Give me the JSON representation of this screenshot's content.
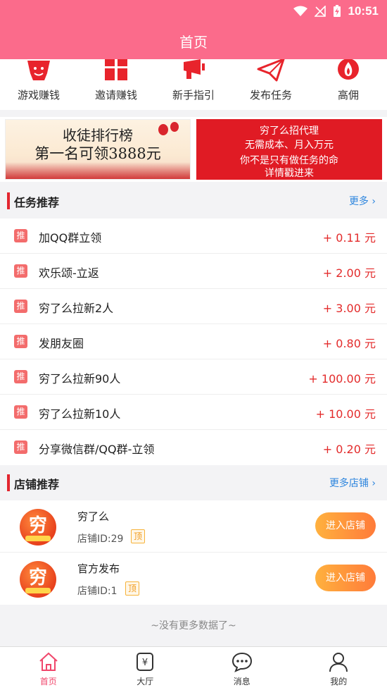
{
  "status": {
    "time": "10:51"
  },
  "header": {
    "title": "首页"
  },
  "quicknav": [
    {
      "label": "游戏赚钱",
      "icon": "smile-star-icon"
    },
    {
      "label": "邀请赚钱",
      "icon": "gift-icon"
    },
    {
      "label": "新手指引",
      "icon": "megaphone-icon"
    },
    {
      "label": "发布任务",
      "icon": "paper-plane-icon"
    },
    {
      "label": "高佣",
      "icon": "flame-icon"
    }
  ],
  "banners": {
    "left": {
      "line1": "收徒排行榜",
      "line2": "第一名可领3888元"
    },
    "right": {
      "line1": "穷了么招代理",
      "line2": "无需成本、月入万元",
      "line3": "你不是只有做任务的命",
      "line4": "详情戳进来"
    }
  },
  "tasks_section": {
    "title": "任务推荐",
    "more": "更多"
  },
  "tasks": [
    {
      "badge": "推",
      "name": "加QQ群立领",
      "price": "+ 0.11 元"
    },
    {
      "badge": "推",
      "name": "欢乐颂-立返",
      "price": "+ 2.00 元"
    },
    {
      "badge": "推",
      "name": "穷了么拉新2人",
      "price": "+ 3.00 元"
    },
    {
      "badge": "推",
      "name": "发朋友圈",
      "price": "+ 0.80 元"
    },
    {
      "badge": "推",
      "name": "穷了么拉新90人",
      "price": "+ 100.00 元"
    },
    {
      "badge": "推",
      "name": "穷了么拉新10人",
      "price": "+ 10.00 元"
    },
    {
      "badge": "推",
      "name": "分享微信群/QQ群-立领",
      "price": "+ 0.20 元"
    }
  ],
  "shops_section": {
    "title": "店铺推荐",
    "more": "更多店铺"
  },
  "shops": [
    {
      "logo_text": "穷",
      "name": "穷了么",
      "id_text": "店铺ID:29",
      "tag": "顶",
      "button": "进入店铺"
    },
    {
      "logo_text": "穷",
      "name": "官方发布",
      "id_text": "店铺ID:1",
      "tag": "顶",
      "button": "进入店铺"
    }
  ],
  "no_more": "~没有更多数据了~",
  "tabbar": [
    {
      "label": "首页",
      "icon": "home-icon",
      "active": true
    },
    {
      "label": "大厅",
      "icon": "yen-icon",
      "active": false
    },
    {
      "label": "消息",
      "icon": "chat-icon",
      "active": false
    },
    {
      "label": "我的",
      "icon": "user-icon",
      "active": false
    }
  ],
  "colors": {
    "header": "#fb6b8b",
    "accent_red": "#e32b2b",
    "link_blue": "#2e86de",
    "orange_btn": "#ff9a3c",
    "tab_active": "#f0466b"
  }
}
